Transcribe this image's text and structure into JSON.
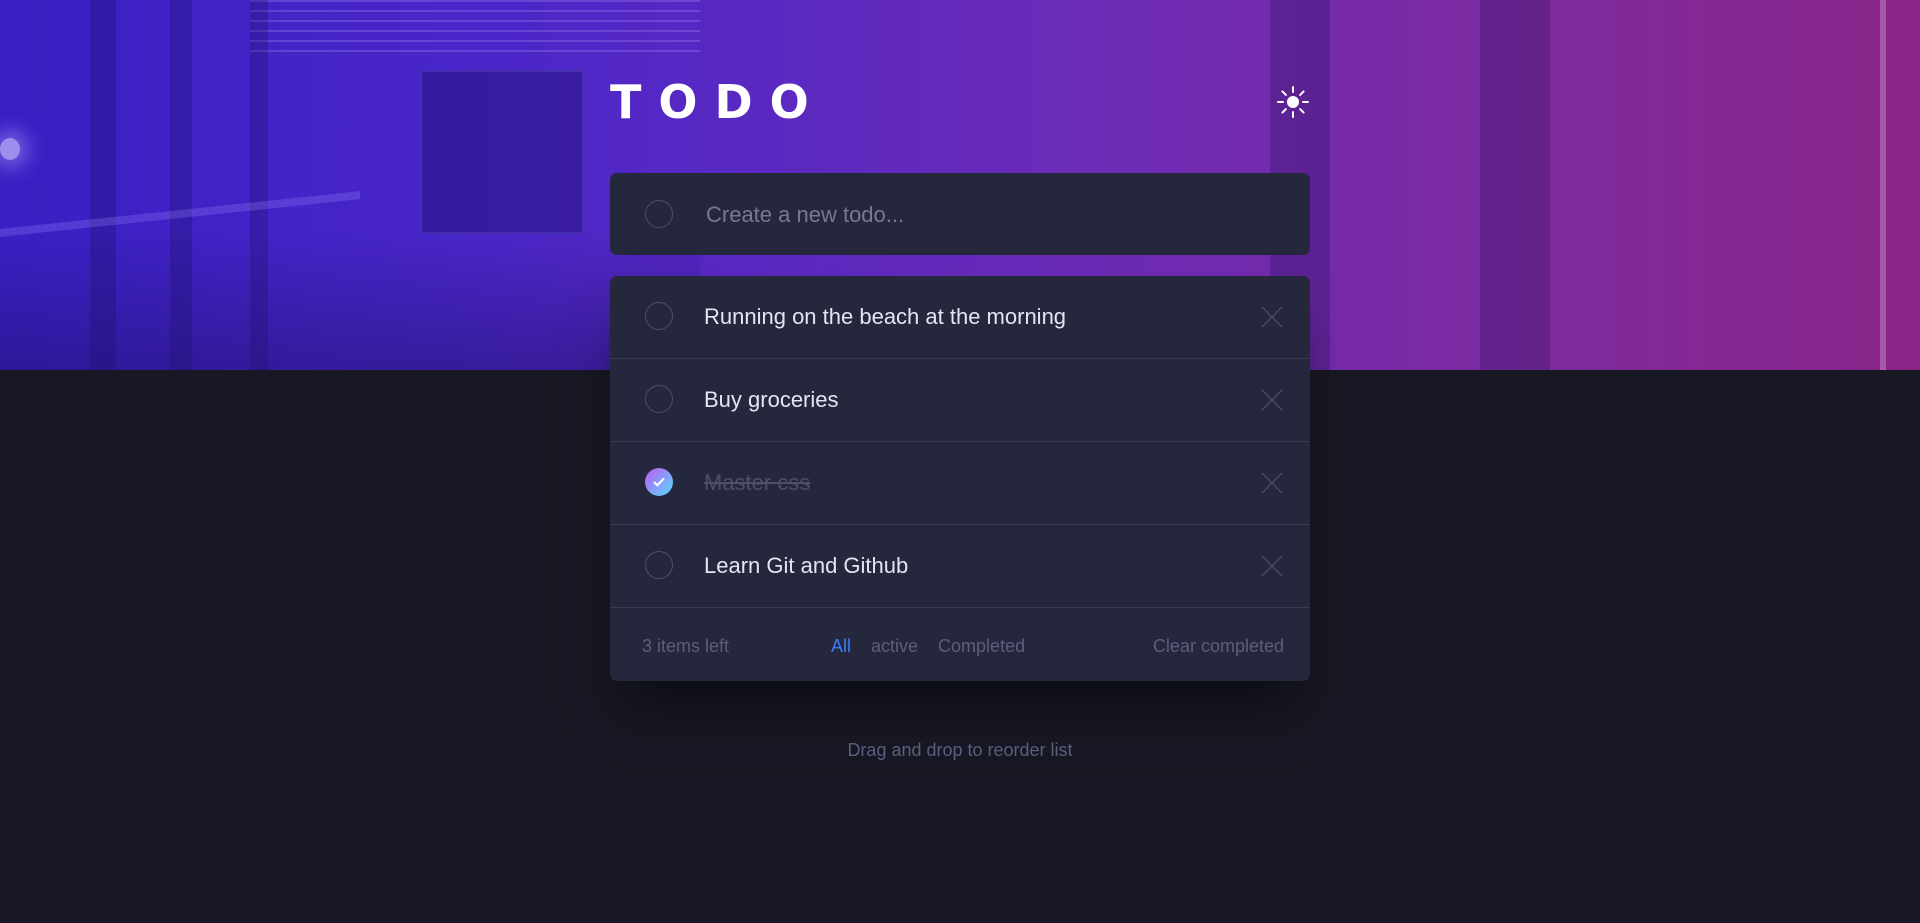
{
  "app": {
    "title": "TODO",
    "theme_icon": "sun-icon"
  },
  "create": {
    "placeholder": "Create a new todo..."
  },
  "todos": [
    {
      "text": "Running on the beach at the morning",
      "completed": false
    },
    {
      "text": "Buy groceries",
      "completed": false
    },
    {
      "text": "Master css",
      "completed": true
    },
    {
      "text": "Learn Git and Github",
      "completed": false
    }
  ],
  "footer": {
    "items_left": "3 items left",
    "filters": [
      "All",
      "active",
      "Completed"
    ],
    "active_filter": "All",
    "clear_label": "Clear completed"
  },
  "hint": "Drag and drop to reorder list",
  "colors": {
    "accent": "#3a7cfd",
    "check_gradient_start": "#c058f3",
    "check_gradient_end": "#55ddff",
    "card_bg": "#25273d",
    "page_bg": "#171823"
  }
}
